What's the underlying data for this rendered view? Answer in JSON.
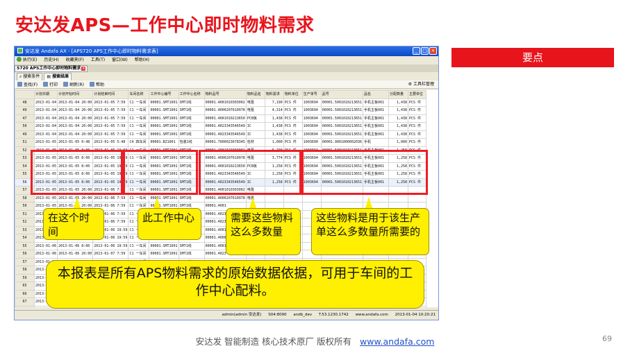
{
  "slide": {
    "title": "安达发APS—工作中心即时物料需求",
    "key_points": "要点",
    "footer": "安达发   智能制造 核心技术原厂   版权所有",
    "footer_link": "www.andafa.com",
    "page_number": "69"
  },
  "window": {
    "title": "安达发 Andafa AX - [APS720 APS工作中心即时物料需求表]",
    "menu": [
      "执行(E)",
      "历史(H)",
      "收藏夹(F)",
      "工具(T)",
      "窗口(W)",
      "帮助(H)"
    ],
    "doc_tab": "S720 APS工作中心即时物料需求",
    "sub_tabs": [
      "搜索条件",
      "搜索结果"
    ],
    "toolbar": [
      "查找(F)",
      "打印",
      "刷新(R)",
      "帮助"
    ],
    "toolbar_right": "工具栏管理",
    "status": [
      "admin(admin 安达发)",
      "S04:8090",
      "andb_dev",
      "T.53.1230.1742",
      "www.andafa.com",
      "2013-01-04 10:20:21"
    ]
  },
  "grid": {
    "columns": [
      "",
      "计划日期",
      "计划开始时间",
      "计划结束时间",
      "车间名称",
      "工作中心编号",
      "工作中心名称",
      "物料品号",
      "物料品名",
      "物料需求",
      "物料单位",
      "生产单号",
      "品号",
      "品名",
      "分配数量",
      "主要单位"
    ],
    "rows": [
      [
        "48",
        "2013-01-04",
        "2013-01-04 20:00",
        "2013-01-05 7:59",
        "C1 一车间",
        "00001.SMT1001",
        "SMT1线",
        "00001.4001010303002",
        "电阻",
        "7,190",
        "PCS 件",
        "1003694",
        "00001.5001010213651",
        "手机主板001",
        "1,438",
        "PCS 件"
      ],
      [
        "49",
        "2013-01-04",
        "2013-01-04 20:00",
        "2013-01-05 7:59",
        "C1 一车间",
        "00001.SMT1001",
        "SMT1线",
        "00001.4000207610978",
        "电阻",
        "4,314",
        "PCS 件",
        "1003694",
        "00001.5001010213651",
        "手机主板001",
        "1,438",
        "PCS 件"
      ],
      [
        "47",
        "2013-01-04",
        "2013-01-04 20:00",
        "2013-01-05 7:59",
        "C1 一车间",
        "00001.SMT1001",
        "SMT1线",
        "00001.4001010213650",
        "PCB板",
        "1,438",
        "PCS 件",
        "1003694",
        "00001.5001010213651",
        "手机主板001",
        "1,438",
        "PCS 件"
      ],
      [
        "50",
        "2013-01-04",
        "2013-01-04 20:00",
        "2013-01-05 7:59",
        "C1 一车间",
        "00001.SMT1001",
        "SMT1线",
        "00001.4023343546549",
        "IC",
        "1,438",
        "PCS 件",
        "1003694",
        "00001.5001010213651",
        "手机主板001",
        "1,438",
        "PCS 件"
      ],
      [
        "49",
        "2013-01-04",
        "2013-01-04 20:00",
        "2013-01-05 7:59",
        "C1 一车间",
        "00001.SMT1001",
        "SMT1线",
        "00001.4023343546549",
        "IC",
        "1,438",
        "PCS 件",
        "1003694",
        "00001.5001010213651",
        "手机主板001",
        "1,438",
        "PCS 件"
      ],
      [
        "51",
        "2013-01-05",
        "2013-01-05 0:48",
        "2013-01-05 5:48",
        "C4 四车间",
        "00001.BZ1001",
        "包装1线",
        "00001.7000023678345",
        "包材",
        "1,000",
        "PCS 件",
        "1003690",
        "00001.9001000002036",
        "手机",
        "1,000",
        "PCS 件"
      ],
      [
        "52",
        "2013-01-05",
        "2013-01-05 8:00",
        "2013-01-05 19:59",
        "C1 一车间",
        "00001.SMT1001",
        "SMT1线",
        "00001.4001010303002",
        "电阻",
        "6,290",
        "PCS 件",
        "1003694",
        "00001.5001010213651",
        "手机主板001",
        "1,258",
        "PCS 件"
      ],
      [
        "53",
        "2013-01-05",
        "2013-01-05 8:00",
        "2013-01-05 19:59",
        "C1 一车间",
        "00001.SMT1001",
        "SMT1线",
        "00001.4000207610978",
        "电阻",
        "3,774",
        "PCS 件",
        "1003694",
        "00001.5001010213651",
        "手机主板001",
        "1,258",
        "PCS 件"
      ],
      [
        "54",
        "2013-01-05",
        "2013-01-05 8:00",
        "2013-01-05 19:59",
        "C1 一车间",
        "00001.SMT1001",
        "SMT1线",
        "00001.4001010213650",
        "PCB板",
        "1,258",
        "PCS 件",
        "1003694",
        "00001.5001010213651",
        "手机主板001",
        "1,258",
        "PCS 件"
      ],
      [
        "55",
        "2013-01-05",
        "2013-01-05 8:00",
        "2013-01-05 19:59",
        "C1 一车间",
        "00001.SMT1001",
        "SMT1线",
        "00001.4023343546549",
        "IC",
        "1,258",
        "PCS 件",
        "1003694",
        "00001.5001010213651",
        "手机主板001",
        "1,258",
        "PCS 件"
      ],
      [
        "56",
        "2013-01-05",
        "2013-01-05 8:00",
        "2013-01-05 19:59",
        "C1 一车间",
        "00001.SMT1001",
        "SMT1线",
        "00001.4023343546549",
        "IC",
        "1,258",
        "PCS 件",
        "1003694",
        "00001.5001010213651",
        "手机主板001",
        "1,258",
        "PCS 件"
      ],
      [
        "57",
        "2013-01-05",
        "2013-01-05 20:00",
        "2013-01-06 7:59",
        "C1 一车间",
        "00001.SMT1001",
        "SMT1线",
        "00001.4001010303002",
        "电阻",
        "",
        "",
        "",
        "",
        "",
        "",
        ""
      ],
      [
        "58",
        "2013-01-05",
        "2013-01-05 20:00",
        "2013-01-06 7:59",
        "C1 一车间",
        "00001.SMT1001",
        "SMT1线",
        "00001.4000207610978",
        "电阻",
        "",
        "",
        "",
        "",
        "",
        "",
        ""
      ],
      [
        "50",
        "2013-01-05",
        "2013-01-05 20:00",
        "2013-01-06 7:59",
        "C1 一车间",
        "00001.SMT1001",
        "SMT1线",
        "00001.4001",
        "",
        "",
        "",
        "",
        "",
        "",
        "",
        ""
      ],
      [
        "51",
        "2013-01-05",
        "2013-01-05 20:00",
        "2013-01-06 7:59",
        "C1 一车间",
        "00001.SMT1001",
        "SMT1线",
        "00001.4023",
        "",
        "",
        "",
        "",
        "",
        "",
        "",
        ""
      ],
      [
        "52",
        "2013-01-05",
        "2013-01-05 20:00",
        "2013-01-06 7:59",
        "C1 一车间",
        "00001.SMT1001",
        "SMT1线",
        "00001.4023",
        "",
        "",
        "",
        "",
        "",
        "",
        "",
        ""
      ],
      [
        "53",
        "2013-01-06",
        "2013-01-06 8:00",
        "2013-01-06 19:59",
        "C1 一车间",
        "00001.SMT1001",
        "SMT1线",
        "00001.4001",
        "",
        "",
        "",
        "",
        "",
        "",
        "",
        ""
      ],
      [
        "54",
        "2013-01-06",
        "2013-01-06 8:00",
        "2013-01-06 19:59",
        "C1 一车间",
        "00001.SMT1001",
        "SMT1线",
        "00001.4000",
        "",
        "",
        "",
        "",
        "",
        "",
        "",
        ""
      ],
      [
        "55",
        "2013-01-06",
        "2013-01-06 8:00",
        "2013-01-06 19:59",
        "C1 一车间",
        "00001.SMT1001",
        "SMT1线",
        "00001.4001",
        "",
        "",
        "",
        "",
        "",
        "",
        "",
        ""
      ],
      [
        "56",
        "2013-01-06",
        "2013-01-06 20:00",
        "2013-01-07 7:59",
        "C1 一车间",
        "00001.SMT1001",
        "SMT1线",
        "00001.4023",
        "",
        "",
        "",
        "",
        "",
        "",
        "",
        ""
      ],
      [
        "57",
        "2013-01-06",
        "2013-01-06 20:00",
        "2013-01-07 7:59",
        "C1 一车间",
        "00001.SMT1001",
        "SMT1线",
        "00001.4023",
        "",
        "",
        "",
        "",
        "",
        "",
        "",
        ""
      ],
      [
        "58",
        "2013-01-07",
        "2013-01-07 8:00",
        "2013-01-07 19:59",
        "C1 一车间",
        "00001.SMT1001",
        "SMT1线",
        "00001.4001",
        "",
        "",
        "",
        "",
        "",
        "",
        "",
        ""
      ],
      [
        "59",
        "2013-01-07",
        "2013-01-07 8:00",
        "2013-01-07 19:59",
        "C1 一车间",
        "00001.SMT1001",
        "SMT1线",
        "00001.4000",
        "",
        "",
        "",
        "",
        "",
        "",
        "",
        ""
      ],
      [
        "65",
        "2013-01-07",
        "2013-01-07 8:00",
        "2013-01-07 19:59",
        "C1 一车间",
        "",
        "",
        "",
        "",
        "",
        "",
        "",
        "",
        "",
        "",
        ""
      ],
      [
        "66",
        "2013-01-07",
        "",
        "",
        "",
        "",
        "",
        "",
        "",
        "",
        "",
        "",
        "",
        "",
        "",
        ""
      ],
      [
        "67",
        "2013-01-07",
        "",
        "",
        "",
        "",
        "",
        "",
        "",
        "",
        "",
        "",
        "",
        "",
        "",
        ""
      ],
      [
        "68",
        "2013-01-07",
        "",
        "",
        "",
        "",
        "",
        "",
        "",
        "",
        "",
        "",
        "",
        "",
        "",
        ""
      ]
    ],
    "selected_row": 10
  },
  "callouts": {
    "time": "在这个时间",
    "work_center": "此工作中心",
    "material": "需要这些物料这么多数量",
    "purpose": "这些物料是用于该生产单这么多数量所需要的",
    "summary": "本报表是所有APS物料需求的原始数据依据，可用于车间的工作中心配料。"
  },
  "colors": {
    "accent": "#e8141c",
    "callout": "#ffef00",
    "highlight": "#ee1c25"
  }
}
